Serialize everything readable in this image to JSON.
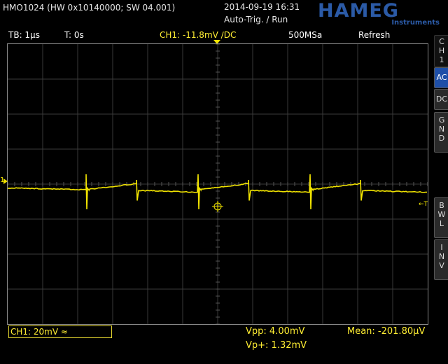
{
  "header": {
    "device_id": "HMO1024 (HW 0x10140000; SW 04.001)",
    "datetime": "2014-09-19 16:31",
    "trigger_status": "Auto-Trig. / Run",
    "logo_text": "HAMEG",
    "logo_sub": "Instruments"
  },
  "info_bar": {
    "timebase": "TB: 1µs",
    "time_offset": "T: 0s",
    "channel_info": "CH1: -11.8mV ∕DC",
    "sample_rate": "500MSa",
    "acq_mode": "Refresh"
  },
  "side_menu": {
    "channel_label": [
      "C",
      "H",
      "1"
    ],
    "ac": "AC",
    "dc": "DC",
    "gnd": [
      "G",
      "N",
      "D"
    ],
    "bwl": [
      "B",
      "W",
      "L"
    ],
    "inv": [
      "I",
      "N",
      "V"
    ]
  },
  "markers": {
    "ch_marker": "1",
    "trigger_marker": "←T"
  },
  "bottom": {
    "channel_scale": "CH1: 20mV ≈",
    "vpp": "Vpp: 4.00mV",
    "vp_plus": "Vp+: 1.32mV",
    "mean": "Mean: -201.80µV"
  },
  "colors": {
    "trace": "#f2e400",
    "grid": "#3a3a3a",
    "active_button": "#1e4fa8"
  },
  "waveform": {
    "timebase_us_per_div": 1,
    "volts_mv_per_div": 20,
    "ramp_period_us": 3.2
  }
}
